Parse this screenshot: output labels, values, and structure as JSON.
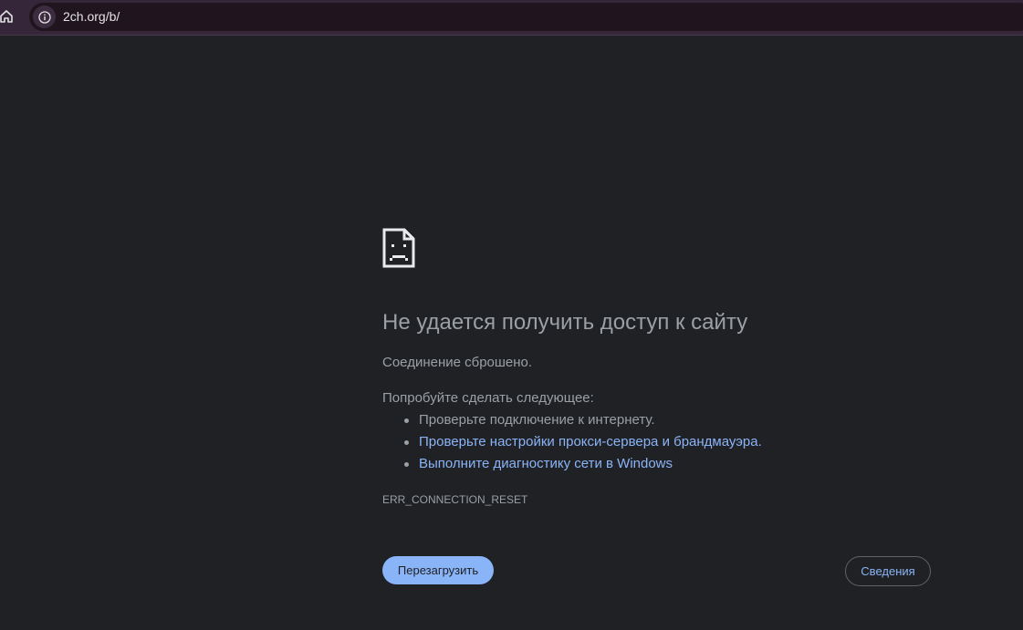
{
  "browser": {
    "url": "2ch.org/b/",
    "icons": {
      "home": "home-icon",
      "site_info": "info-icon"
    }
  },
  "error_page": {
    "icon": "sad-file-icon",
    "title": "Не удается получить доступ к сайту",
    "message": "Соединение сброшено.",
    "suggestions_heading": "Попробуйте сделать следующее:",
    "suggestions": [
      {
        "text": "Проверьте подключение к интернету.",
        "link": false
      },
      {
        "text": "Проверьте настройки прокси-сервера и брандмауэра.",
        "link": true
      },
      {
        "text": "Выполните диагностику сети в Windows",
        "link": true
      }
    ],
    "error_code": "ERR_CONNECTION_RESET",
    "reload_label": "Перезагрузить",
    "details_label": "Сведения"
  },
  "colors": {
    "page_background": "#202124",
    "toolbar_background": "#35263a",
    "text": "#9aa0a6",
    "link": "#8ab4f8",
    "primary_button": "#8ab4f8"
  }
}
